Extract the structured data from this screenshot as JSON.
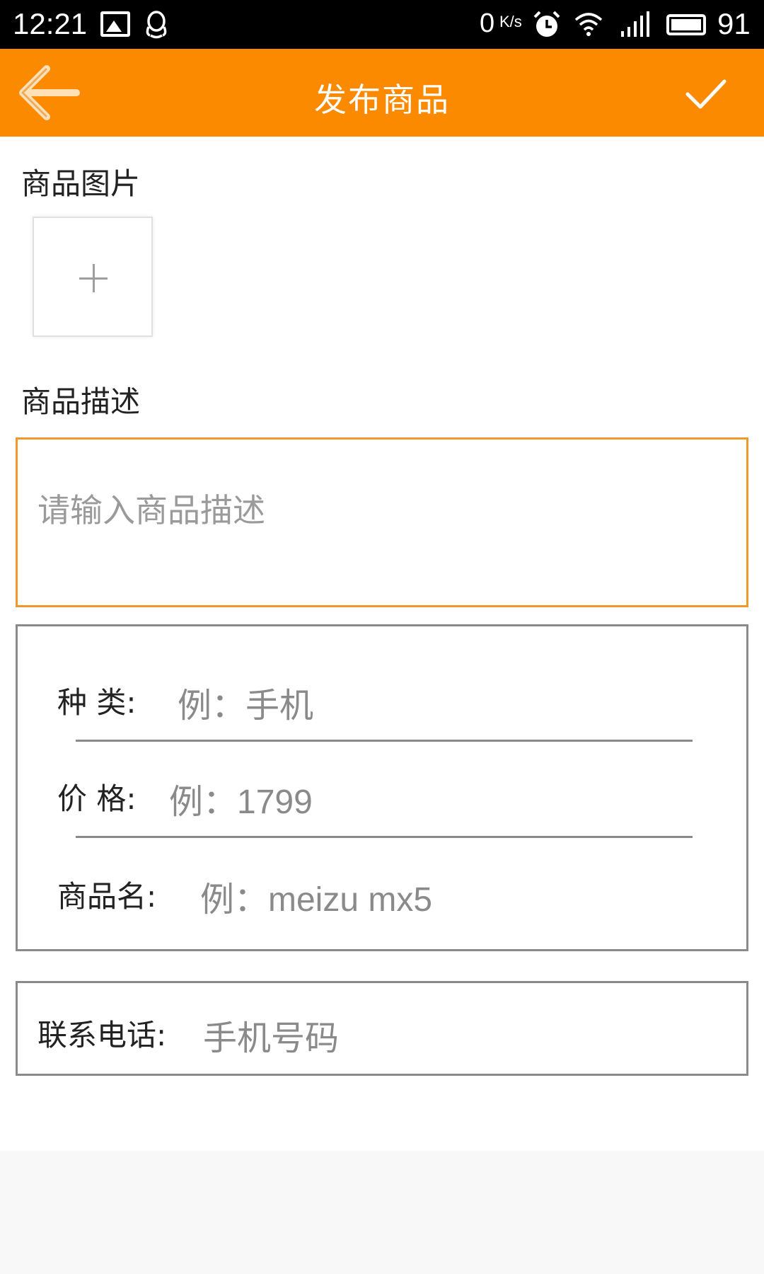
{
  "status_bar": {
    "time": "12:21",
    "net_speed": "0",
    "net_speed_unit": "K/s",
    "battery": "91",
    "icons": [
      "gallery-icon",
      "qq-icon",
      "alarm-icon",
      "wifi-icon",
      "signal-icon",
      "battery-icon"
    ]
  },
  "app_bar": {
    "title": "发布商品",
    "back_icon": "back-arrow-icon",
    "confirm_icon": "checkmark-icon",
    "color": "#fb8a00"
  },
  "photos": {
    "label": "商品图片",
    "add_icon": "plus-icon"
  },
  "description": {
    "label": "商品描述",
    "placeholder": "请输入商品描述",
    "value": "",
    "border_color": "#ee9a2a"
  },
  "details": {
    "category": {
      "label": "种 类:",
      "placeholder": "例：手机"
    },
    "price": {
      "label": "价 格:",
      "placeholder": "例：1799"
    },
    "name": {
      "label": "商品名:",
      "placeholder": "例：meizu mx5"
    }
  },
  "contact": {
    "label": "联系电话:",
    "placeholder": "手机号码"
  }
}
